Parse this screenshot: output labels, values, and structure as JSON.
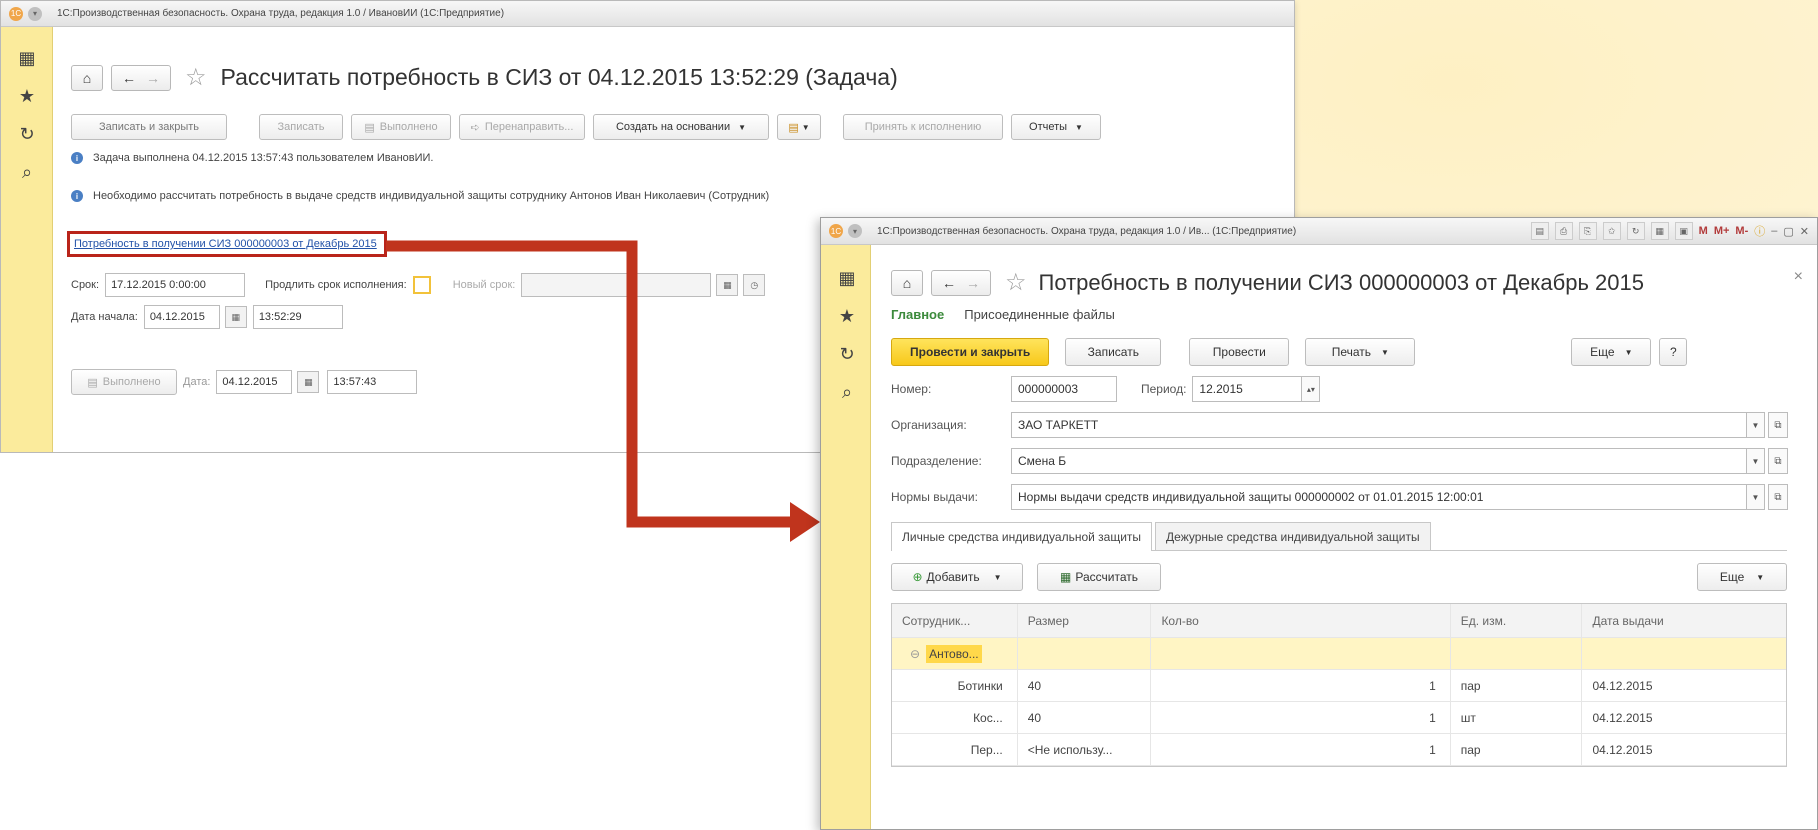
{
  "window1": {
    "titlebar": "1С:Производственная безопасность. Охрана труда, редакция 1.0 / ИвановИИ (1С:Предприятие)",
    "title": "Рассчитать потребность в СИЗ от 04.12.2015 13:52:29 (Задача)",
    "buttons": {
      "save_close": "Записать и закрыть",
      "save": "Записать",
      "done": "Выполнено",
      "redirect": "Перенаправить...",
      "create_based": "Создать на основании",
      "accept": "Принять к исполнению",
      "reports": "Отчеты"
    },
    "info_done": "Задача выполнена 04.12.2015 13:57:43 пользователем ИвановИИ.",
    "info_need": "Необходимо рассчитать потребность в выдаче средств индивидуальной защиты сотруднику Антонов Иван Николаевич (Сотрудник)",
    "link": "Потребность в получении СИЗ 000000003 от Декабрь 2015",
    "deadline_label": "Срок:",
    "deadline_value": "17.12.2015  0:00:00",
    "extend_label": "Продлить срок исполнения:",
    "new_deadline_label": "Новый срок:",
    "start_label": "Дата начала:",
    "start_date": "04.12.2015",
    "start_time": "13:52:29",
    "done_btn": "Выполнено",
    "date_label": "Дата:",
    "done_date": "04.12.2015",
    "done_time": "13:57:43"
  },
  "window2": {
    "titlebar": "1С:Производственная безопасность. Охрана труда, редакция 1.0 / Ив...  (1С:Предприятие)",
    "title": "Потребность в получении СИЗ 000000003 от Декабрь 2015",
    "tabs": {
      "main": "Главное",
      "files": "Присоединенные файлы"
    },
    "buttons": {
      "post_close": "Провести и закрыть",
      "save": "Записать",
      "post": "Провести",
      "print": "Печать",
      "more": "Еще",
      "help": "?"
    },
    "number_label": "Номер:",
    "number_value": "000000003",
    "period_label": "Период:",
    "period_value": "12.2015",
    "org_label": "Организация:",
    "org_value": "ЗАО ТАРКЕТТ",
    "dept_label": "Подразделение:",
    "dept_value": "Смена Б",
    "norms_label": "Нормы выдачи:",
    "norms_value": "Нормы выдачи средств индивидуальной защиты 000000002 от 01.01.2015 12:00:01",
    "inner_tabs": [
      "Личные средства индивидуальной защиты",
      "Дежурные средства индивидуальной защиты"
    ],
    "add_btn": "Добавить",
    "calc_btn": "Рассчитать",
    "grid_more": "Еще",
    "columns": [
      "Сотрудник...",
      "Размер",
      "Кол-во",
      "Ед. изм.",
      "Дата выдачи"
    ],
    "group_row": "Антово...",
    "rows": [
      {
        "name": "Ботинки",
        "size": "40",
        "qty": "1",
        "unit": "пар",
        "date": "04.12.2015"
      },
      {
        "name": "Кос...",
        "size": "40",
        "qty": "1",
        "unit": "шт",
        "date": "04.12.2015"
      },
      {
        "name": "Пер...",
        "size": "<Не использу...",
        "qty": "1",
        "unit": "пар",
        "date": "04.12.2015"
      }
    ],
    "tb_tools": [
      "M",
      "M+",
      "M-"
    ]
  }
}
